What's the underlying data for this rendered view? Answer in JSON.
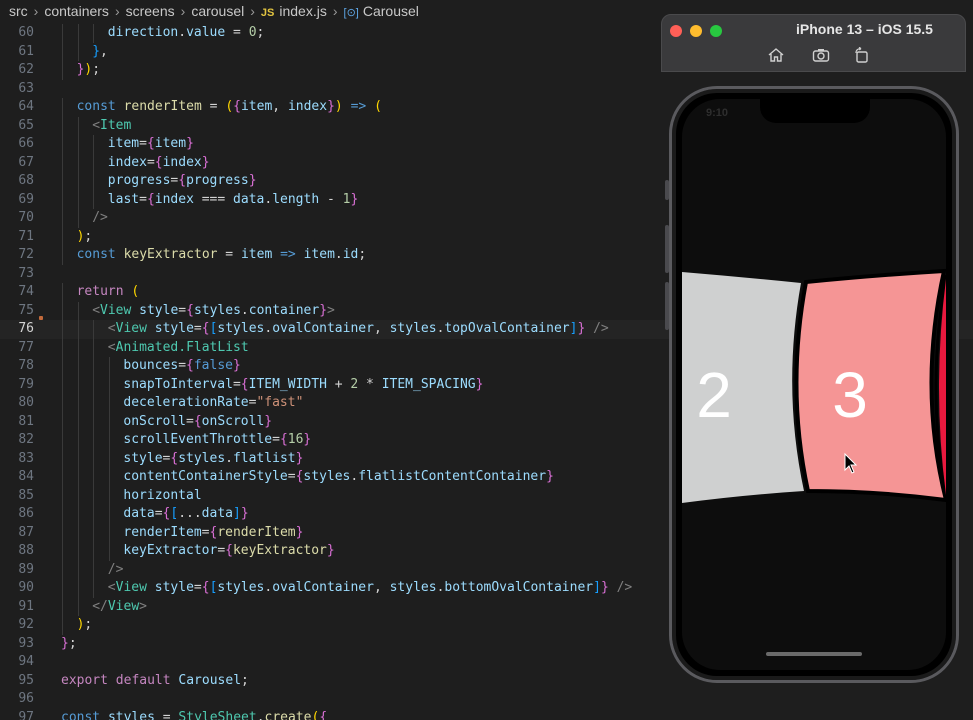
{
  "breadcrumb": {
    "items": [
      "src",
      "containers",
      "screens",
      "carousel"
    ],
    "file_badge": "JS",
    "file": "index.js",
    "symbol_icon": "[⊙]",
    "symbol": "Carousel"
  },
  "editor": {
    "current_line": 76,
    "lines": [
      {
        "n": 60,
        "indent": 6
      },
      {
        "n": 61,
        "indent": 4
      },
      {
        "n": 62,
        "indent": 2
      },
      {
        "n": 63,
        "indent": 0
      },
      {
        "n": 64,
        "indent": 2
      },
      {
        "n": 65,
        "indent": 4
      },
      {
        "n": 66,
        "indent": 6
      },
      {
        "n": 67,
        "indent": 6
      },
      {
        "n": 68,
        "indent": 6
      },
      {
        "n": 69,
        "indent": 6
      },
      {
        "n": 70,
        "indent": 4
      },
      {
        "n": 71,
        "indent": 2
      },
      {
        "n": 72,
        "indent": 2
      },
      {
        "n": 73,
        "indent": 0
      },
      {
        "n": 74,
        "indent": 2
      },
      {
        "n": 75,
        "indent": 4
      },
      {
        "n": 76,
        "indent": 6
      },
      {
        "n": 77,
        "indent": 6
      },
      {
        "n": 78,
        "indent": 8
      },
      {
        "n": 79,
        "indent": 8
      },
      {
        "n": 80,
        "indent": 8
      },
      {
        "n": 81,
        "indent": 8
      },
      {
        "n": 82,
        "indent": 8
      },
      {
        "n": 83,
        "indent": 8
      },
      {
        "n": 84,
        "indent": 8
      },
      {
        "n": 85,
        "indent": 8
      },
      {
        "n": 86,
        "indent": 8
      },
      {
        "n": 87,
        "indent": 8
      },
      {
        "n": 88,
        "indent": 8
      },
      {
        "n": 89,
        "indent": 6
      },
      {
        "n": 90,
        "indent": 6
      },
      {
        "n": 91,
        "indent": 4
      },
      {
        "n": 92,
        "indent": 2
      },
      {
        "n": 93,
        "indent": 0
      },
      {
        "n": 94,
        "indent": 0
      },
      {
        "n": 95,
        "indent": 0
      },
      {
        "n": 96,
        "indent": 0
      },
      {
        "n": 97,
        "indent": 0
      }
    ],
    "tokens": {
      "60": [
        [
          "vr",
          "direction"
        ],
        [
          "pu",
          "."
        ],
        [
          "vr",
          "value"
        ],
        [
          "pu",
          " = "
        ],
        [
          "num",
          "0"
        ],
        [
          "pu",
          ";"
        ]
      ],
      "61": [
        [
          "br3",
          "}"
        ],
        [
          "pu",
          ","
        ]
      ],
      "62": [
        [
          "br2",
          "}"
        ],
        [
          "br1",
          ")"
        ],
        [
          "pu",
          ";"
        ]
      ],
      "63": [],
      "64": [
        [
          "st",
          "const "
        ],
        [
          "fn",
          "renderItem"
        ],
        [
          "pu",
          " = "
        ],
        [
          "br1",
          "("
        ],
        [
          "br2",
          "{"
        ],
        [
          "vr",
          "item"
        ],
        [
          "pu",
          ", "
        ],
        [
          "vr",
          "index"
        ],
        [
          "br2",
          "}"
        ],
        [
          "br1",
          ")"
        ],
        [
          "pu",
          " "
        ],
        [
          "st",
          "=>"
        ],
        [
          "pu",
          " "
        ],
        [
          "br1",
          "("
        ]
      ],
      "65": [
        [
          "gt",
          "<"
        ],
        [
          "tg",
          "Item"
        ]
      ],
      "66": [
        [
          "at",
          "item"
        ],
        [
          "pu",
          "="
        ],
        [
          "br2",
          "{"
        ],
        [
          "vr",
          "item"
        ],
        [
          "br2",
          "}"
        ]
      ],
      "67": [
        [
          "at",
          "index"
        ],
        [
          "pu",
          "="
        ],
        [
          "br2",
          "{"
        ],
        [
          "vr",
          "index"
        ],
        [
          "br2",
          "}"
        ]
      ],
      "68": [
        [
          "at",
          "progress"
        ],
        [
          "pu",
          "="
        ],
        [
          "br2",
          "{"
        ],
        [
          "vr",
          "progress"
        ],
        [
          "br2",
          "}"
        ]
      ],
      "69": [
        [
          "at",
          "last"
        ],
        [
          "pu",
          "="
        ],
        [
          "br2",
          "{"
        ],
        [
          "vr",
          "index"
        ],
        [
          "pu",
          " === "
        ],
        [
          "vr",
          "data"
        ],
        [
          "pu",
          "."
        ],
        [
          "vr",
          "length"
        ],
        [
          "pu",
          " - "
        ],
        [
          "num",
          "1"
        ],
        [
          "br2",
          "}"
        ]
      ],
      "70": [
        [
          "gt",
          "/>"
        ]
      ],
      "71": [
        [
          "br1",
          ")"
        ],
        [
          "pu",
          ";"
        ]
      ],
      "72": [
        [
          "st",
          "const "
        ],
        [
          "fn",
          "keyExtractor"
        ],
        [
          "pu",
          " = "
        ],
        [
          "vr",
          "item"
        ],
        [
          "pu",
          " "
        ],
        [
          "st",
          "=>"
        ],
        [
          "pu",
          " "
        ],
        [
          "vr",
          "item"
        ],
        [
          "pu",
          "."
        ],
        [
          "vr",
          "id"
        ],
        [
          "pu",
          ";"
        ]
      ],
      "73": [],
      "74": [
        [
          "kw",
          "return "
        ],
        [
          "br1",
          "("
        ]
      ],
      "75": [
        [
          "gt",
          "<"
        ],
        [
          "tg",
          "View "
        ],
        [
          "at",
          "style"
        ],
        [
          "pu",
          "="
        ],
        [
          "br2",
          "{"
        ],
        [
          "vr",
          "styles"
        ],
        [
          "pu",
          "."
        ],
        [
          "vr",
          "container"
        ],
        [
          "br2",
          "}"
        ],
        [
          "gt",
          ">"
        ]
      ],
      "76": [
        [
          "gt",
          "<"
        ],
        [
          "tg",
          "View "
        ],
        [
          "at",
          "style"
        ],
        [
          "pu",
          "="
        ],
        [
          "br2",
          "{"
        ],
        [
          "br3",
          "["
        ],
        [
          "vr",
          "styles"
        ],
        [
          "pu",
          "."
        ],
        [
          "vr",
          "ovalContainer"
        ],
        [
          "pu",
          ", "
        ],
        [
          "vr",
          "styles"
        ],
        [
          "pu",
          "."
        ],
        [
          "vr",
          "topOvalContainer"
        ],
        [
          "br3",
          "]"
        ],
        [
          "br2",
          "}"
        ],
        [
          "gt",
          " />"
        ]
      ],
      "77": [
        [
          "gt",
          "<"
        ],
        [
          "tg",
          "Animated.FlatList"
        ]
      ],
      "78": [
        [
          "at",
          "bounces"
        ],
        [
          "pu",
          "="
        ],
        [
          "br2",
          "{"
        ],
        [
          "st",
          "false"
        ],
        [
          "br2",
          "}"
        ]
      ],
      "79": [
        [
          "at",
          "snapToInterval"
        ],
        [
          "pu",
          "="
        ],
        [
          "br2",
          "{"
        ],
        [
          "vr",
          "ITEM_WIDTH"
        ],
        [
          "pu",
          " + "
        ],
        [
          "num",
          "2"
        ],
        [
          "pu",
          " * "
        ],
        [
          "vr",
          "ITEM_SPACING"
        ],
        [
          "br2",
          "}"
        ]
      ],
      "80": [
        [
          "at",
          "decelerationRate"
        ],
        [
          "pu",
          "="
        ],
        [
          "str",
          "\"fast\""
        ]
      ],
      "81": [
        [
          "at",
          "onScroll"
        ],
        [
          "pu",
          "="
        ],
        [
          "br2",
          "{"
        ],
        [
          "vr",
          "onScroll"
        ],
        [
          "br2",
          "}"
        ]
      ],
      "82": [
        [
          "at",
          "scrollEventThrottle"
        ],
        [
          "pu",
          "="
        ],
        [
          "br2",
          "{"
        ],
        [
          "num",
          "16"
        ],
        [
          "br2",
          "}"
        ]
      ],
      "83": [
        [
          "at",
          "style"
        ],
        [
          "pu",
          "="
        ],
        [
          "br2",
          "{"
        ],
        [
          "vr",
          "styles"
        ],
        [
          "pu",
          "."
        ],
        [
          "vr",
          "flatlist"
        ],
        [
          "br2",
          "}"
        ]
      ],
      "84": [
        [
          "at",
          "contentContainerStyle"
        ],
        [
          "pu",
          "="
        ],
        [
          "br2",
          "{"
        ],
        [
          "vr",
          "styles"
        ],
        [
          "pu",
          "."
        ],
        [
          "vr",
          "flatlistContentContainer"
        ],
        [
          "br2",
          "}"
        ]
      ],
      "85": [
        [
          "at",
          "horizontal"
        ]
      ],
      "86": [
        [
          "at",
          "data"
        ],
        [
          "pu",
          "="
        ],
        [
          "br2",
          "{"
        ],
        [
          "br3",
          "["
        ],
        [
          "pu",
          "..."
        ],
        [
          "vr",
          "data"
        ],
        [
          "br3",
          "]"
        ],
        [
          "br2",
          "}"
        ]
      ],
      "87": [
        [
          "at",
          "renderItem"
        ],
        [
          "pu",
          "="
        ],
        [
          "br2",
          "{"
        ],
        [
          "fn",
          "renderItem"
        ],
        [
          "br2",
          "}"
        ]
      ],
      "88": [
        [
          "at",
          "keyExtractor"
        ],
        [
          "pu",
          "="
        ],
        [
          "br2",
          "{"
        ],
        [
          "fn",
          "keyExtractor"
        ],
        [
          "br2",
          "}"
        ]
      ],
      "89": [
        [
          "gt",
          "/>"
        ]
      ],
      "90": [
        [
          "gt",
          "<"
        ],
        [
          "tg",
          "View "
        ],
        [
          "at",
          "style"
        ],
        [
          "pu",
          "="
        ],
        [
          "br2",
          "{"
        ],
        [
          "br3",
          "["
        ],
        [
          "vr",
          "styles"
        ],
        [
          "pu",
          "."
        ],
        [
          "vr",
          "ovalContainer"
        ],
        [
          "pu",
          ", "
        ],
        [
          "vr",
          "styles"
        ],
        [
          "pu",
          "."
        ],
        [
          "vr",
          "bottomOvalContainer"
        ],
        [
          "br3",
          "]"
        ],
        [
          "br2",
          "}"
        ],
        [
          "gt",
          " />"
        ]
      ],
      "91": [
        [
          "gt",
          "</"
        ],
        [
          "tg",
          "View"
        ],
        [
          "gt",
          ">"
        ]
      ],
      "92": [
        [
          "br1",
          ")"
        ],
        [
          "pu",
          ";"
        ]
      ],
      "93": [
        [
          "br2",
          "}"
        ],
        [
          "pu",
          ";"
        ]
      ],
      "94": [],
      "95": [
        [
          "kw",
          "export default "
        ],
        [
          "vr",
          "Carousel"
        ],
        [
          "pu",
          ";"
        ]
      ],
      "96": [],
      "97": [
        [
          "st",
          "const "
        ],
        [
          "vr",
          "styles"
        ],
        [
          "pu",
          " = "
        ],
        [
          "tg",
          "StyleSheet"
        ],
        [
          "pu",
          "."
        ],
        [
          "fn",
          "create"
        ],
        [
          "br1",
          "("
        ],
        [
          "br2",
          "{"
        ]
      ]
    }
  },
  "simulator": {
    "title": "iPhone 13 – iOS 15.5",
    "controls": [
      "home-icon",
      "screenshot-icon",
      "rotate-icon"
    ],
    "status_time": "9:10",
    "cards": [
      {
        "label": "2",
        "color": "#cfd0d0"
      },
      {
        "label": "3",
        "color": "#f59595"
      },
      {
        "label": "",
        "color": "#e8193e"
      }
    ]
  }
}
